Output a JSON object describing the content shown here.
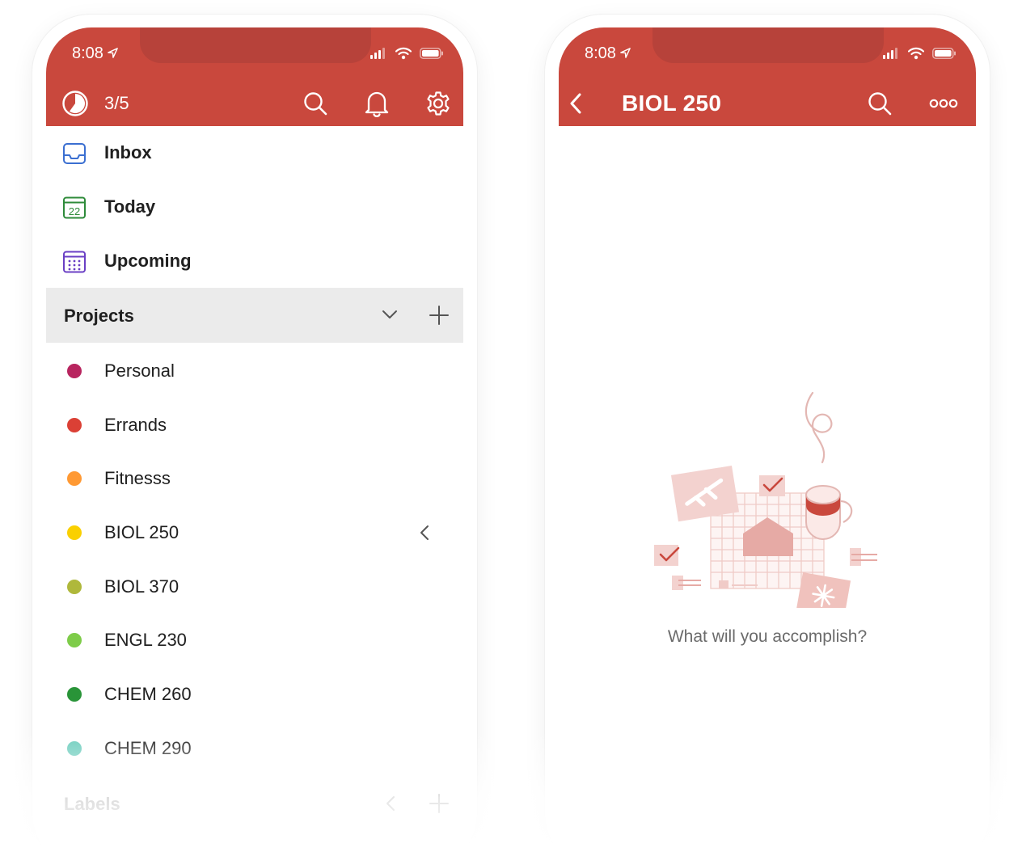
{
  "left_phone": {
    "status": {
      "time": "8:08"
    },
    "toolbar": {
      "progress": "3/5",
      "progress_fraction": 0.6
    },
    "nav": [
      {
        "label": "Inbox",
        "icon": "inbox-icon",
        "color": "#3b6fd1"
      },
      {
        "label": "Today",
        "icon": "calendar-today-icon",
        "day": "22",
        "color": "#2e8b3a"
      },
      {
        "label": "Upcoming",
        "icon": "calendar-upcoming-icon",
        "color": "#6a3fc4"
      }
    ],
    "projects_header": {
      "label": "Projects"
    },
    "projects": [
      {
        "label": "Personal",
        "color": "#b8255f"
      },
      {
        "label": "Errands",
        "color": "#db4035"
      },
      {
        "label": "Fitnesss",
        "color": "#ff9933"
      },
      {
        "label": "BIOL 250",
        "color": "#fad000"
      },
      {
        "label": "BIOL 370",
        "color": "#afb83b"
      },
      {
        "label": "ENGL 230",
        "color": "#7ecc49"
      },
      {
        "label": "CHEM 260",
        "color": "#299438"
      },
      {
        "label": "CHEM 290",
        "color": "#6accbc"
      }
    ],
    "labels_header": {
      "label": "Labels"
    }
  },
  "right_phone": {
    "status": {
      "time": "8:08"
    },
    "toolbar": {
      "title": "BIOL 250"
    },
    "empty_state": {
      "message": "What will you accomplish?"
    }
  },
  "colors": {
    "accent": "#c9483d",
    "notch": "#b7423a",
    "header_bg": "#ebebeb"
  }
}
